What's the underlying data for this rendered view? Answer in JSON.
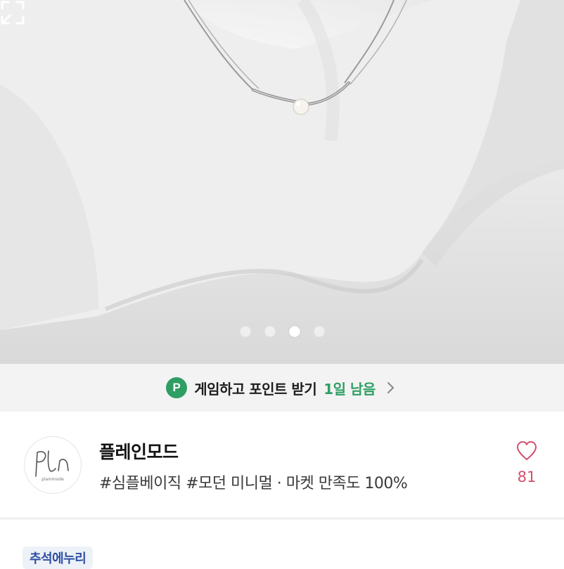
{
  "product_image": {
    "alt": "silver pearl necklace on white fabric",
    "carousel": {
      "count": 4,
      "active_index": 2
    },
    "expand_icon": "expand-icon"
  },
  "game_banner": {
    "badge": "P",
    "text": "게임하고 포인트 받기",
    "days_left": "1일 남음",
    "accent_color": "#2f9e63"
  },
  "shop": {
    "name": "플레인모드",
    "description": "#심플베이직 #모던 미니멀 · 마켓 만족도 100%",
    "logo_text": "plainmode",
    "like_count": "81",
    "heart_color": "#d4506e"
  },
  "section_chip": {
    "label": "추석에누리"
  }
}
